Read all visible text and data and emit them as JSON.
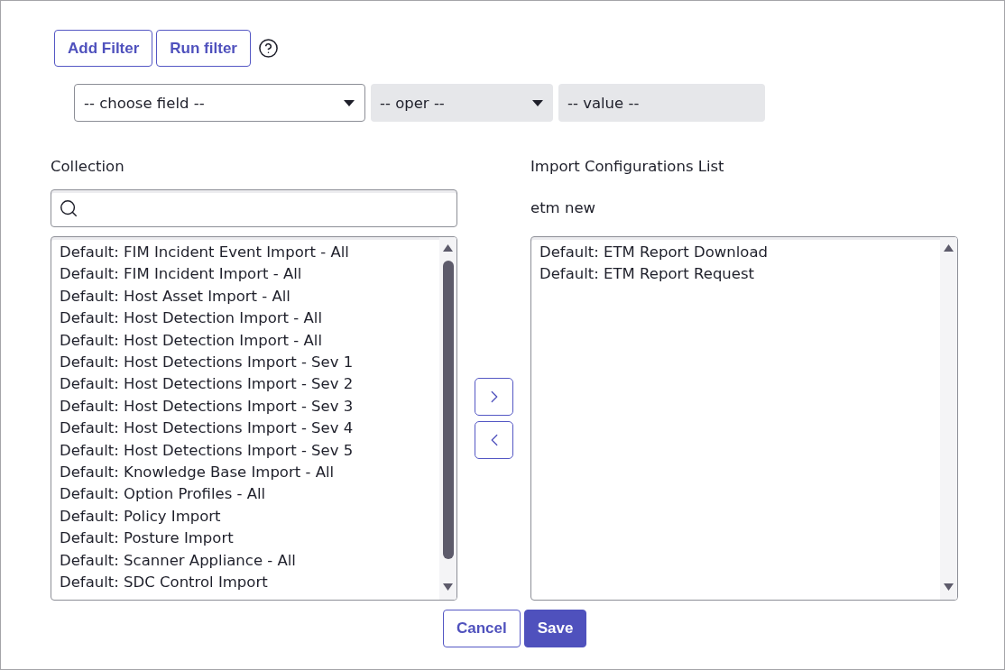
{
  "filter_toolbar": {
    "buttons": [
      "Add Filter",
      "Run filter"
    ]
  },
  "filter_row": {
    "field_select": {
      "value": "-- choose field --",
      "disabled": false
    },
    "operator_select": {
      "value": "-- oper --",
      "disabled": true
    },
    "value_field": {
      "value": "-- value --",
      "disabled": true
    }
  },
  "collection": {
    "label": "Collection",
    "items": [
      {
        "label": "Default: FIM Incident Event Import - All",
        "selected": false
      },
      {
        "label": "Default: FIM Incident Import - All",
        "selected": false
      },
      {
        "label": "Default: Host Asset Import - All",
        "selected": false
      },
      {
        "label": "Default: Host Detection Import - All",
        "selected": false
      },
      {
        "label": "Default: Host Detection Import - All",
        "selected": false
      },
      {
        "label": "Default: Host Detections Import - Sev 1",
        "selected": false
      },
      {
        "label": "Default: Host Detections Import - Sev 2",
        "selected": false
      },
      {
        "label": "Default: Host Detections Import - Sev 3",
        "selected": false
      },
      {
        "label": "Default: Host Detections Import - Sev 4",
        "selected": false
      },
      {
        "label": "Default: Host Detections Import - Sev 5",
        "selected": false
      },
      {
        "label": "Default: Knowledge Base Import - All",
        "selected": false
      },
      {
        "label": "Default: Option Profiles - All",
        "selected": false
      },
      {
        "label": "Default: Policy Import",
        "selected": false
      },
      {
        "label": "Default: Posture Import",
        "selected": false
      },
      {
        "label": "Default: Scanner Appliance - All",
        "selected": false
      },
      {
        "label": "Default: SDC Control Import",
        "selected": false
      }
    ]
  },
  "import_configurations": {
    "label": "Import Configurations List",
    "name": "etm new",
    "items": [
      {
        "label": "Default: ETM Report Download",
        "selected": false
      },
      {
        "label": "Default: ETM Report Request",
        "selected": false
      }
    ]
  },
  "actions": [
    {
      "label": "Cancel",
      "kind": "secondary"
    },
    {
      "label": "Save",
      "kind": "primary"
    }
  ]
}
